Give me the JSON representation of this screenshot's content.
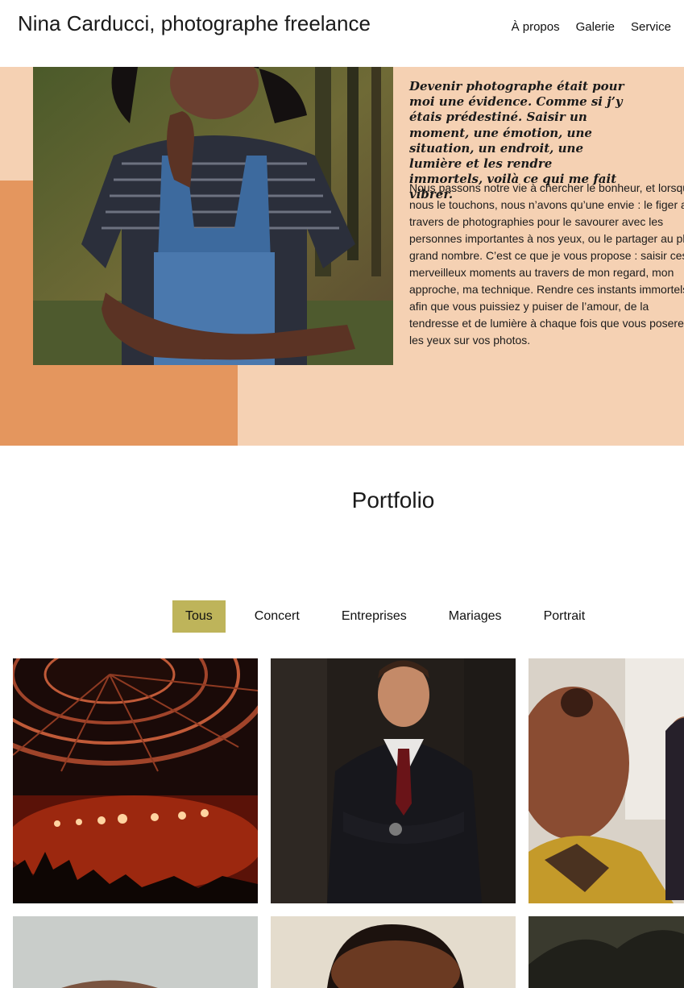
{
  "header": {
    "title": "Nina Carducci, photographe freelance",
    "nav": [
      {
        "label": "À propos"
      },
      {
        "label": "Galerie"
      },
      {
        "label": "Service"
      }
    ]
  },
  "about": {
    "quote": "Devenir photographe était pour moi une évidence. Comme si j’y étais prédestiné. Saisir un moment, une émotion, une situation, un endroit, une lumière et les rendre immortels, voilà ce qui me fait vibrer.",
    "text": "Nous passons notre vie à chercher le bonheur, et lorsque nous le touchons, nous n’avons qu’une envie : le figer au travers de photographies pour le savourer avec les personnes importantes à nos yeux, ou le partager au plus grand nombre. C’est ce que je vous propose : saisir ces merveilleux moments au travers de mon regard, mon approche, ma technique. Rendre ces instants immortels, afin que vous puissiez y puiser de l’amour, de la tendresse et de lumière à chaque fois que vous poserez les yeux sur vos photos."
  },
  "portfolio": {
    "title": "Portfolio",
    "filters": [
      {
        "label": "Tous",
        "active": true
      },
      {
        "label": "Concert",
        "active": false
      },
      {
        "label": "Entreprises",
        "active": false
      },
      {
        "label": "Mariages",
        "active": false
      },
      {
        "label": "Portrait",
        "active": false
      }
    ]
  },
  "colors": {
    "peach": "#f5d1b3",
    "orange": "#e4965e",
    "active_filter": "#beb45a"
  }
}
